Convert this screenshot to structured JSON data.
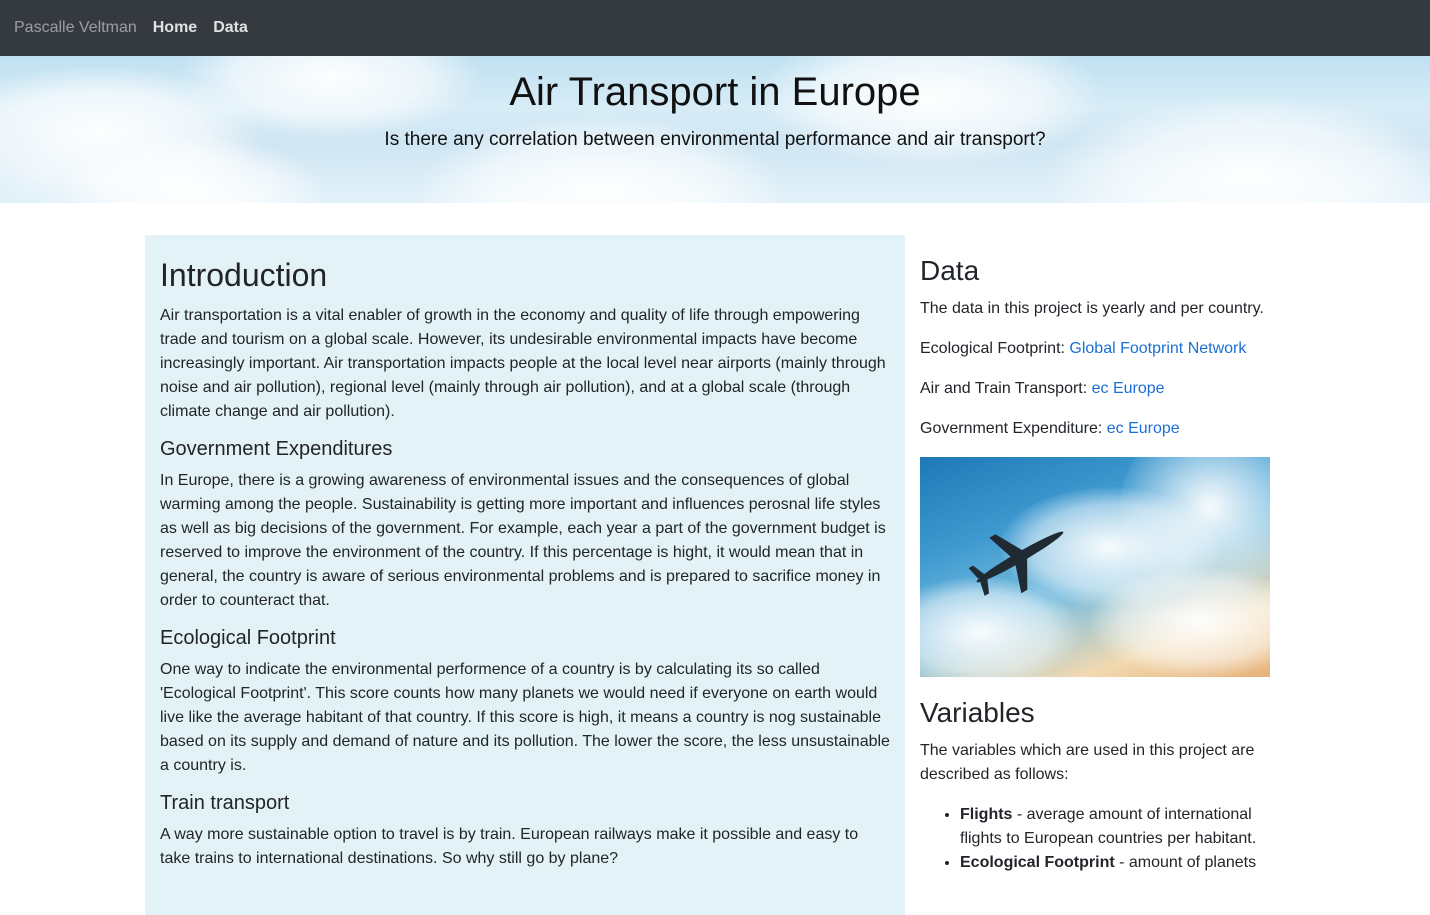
{
  "nav": {
    "brand": "Pascalle Veltman",
    "links": [
      "Home",
      "Data"
    ]
  },
  "hero": {
    "title": "Air Transport in Europe",
    "subtitle": "Is there any correlation between environmental performance and air transport?"
  },
  "main": {
    "intro_heading": "Introduction",
    "intro_text": "Air transportation is a vital enabler of growth in the economy and quality of life through empowering trade and tourism on a global scale. However, its undesirable environmental impacts have become increasingly important. Air transportation impacts people at the local level near airports (mainly through noise and air pollution), regional level (mainly through air pollution), and at a global scale (through climate change and air pollution).",
    "gov_heading": "Government Expenditures",
    "gov_text": "In Europe, there is a growing awareness of environmental issues and the consequences of global warming among the people. Sustainability is getting more important and influences perosnal life styles as well as big decisions of the government. For example, each year a part of the government budget is reserved to improve the environment of the country. If this percentage is hight, it would mean that in general, the country is aware of serious environmental problems and is prepared to sacrifice money in order to counteract that.",
    "eco_heading": "Ecological Footprint",
    "eco_text": "One way to indicate the environmental performence of a country is by calculating its so called 'Ecological Footprint'. This score counts how many planets we would need if everyone on earth would live like the average habitant of that country. If this score is high, it means a country is nog sustainable based on its supply and demand of nature and its pollution. The lower the score, the less unsustainable a country is.",
    "train_heading": "Train transport",
    "train_text": "A way more sustainable option to travel is by train. European railways make it possible and easy to take trains to international destinations. So why still go by plane?"
  },
  "side": {
    "data_heading": "Data",
    "data_text": "The data in this project is yearly and per country.",
    "sources": [
      {
        "label": "Ecological Footprint: ",
        "link": "Global Footprint Network"
      },
      {
        "label": "Air and Train Transport: ",
        "link": "ec Europe"
      },
      {
        "label": "Government Expenditure: ",
        "link": "ec Europe"
      }
    ],
    "variables_heading": "Variables",
    "variables_text": "The variables which are used in this project are described as follows:",
    "variables": [
      {
        "term": "Flights",
        "desc": " - average amount of international flights to European countries per habitant."
      },
      {
        "term": "Ecological Footprint",
        "desc": " - amount of planets"
      }
    ]
  }
}
